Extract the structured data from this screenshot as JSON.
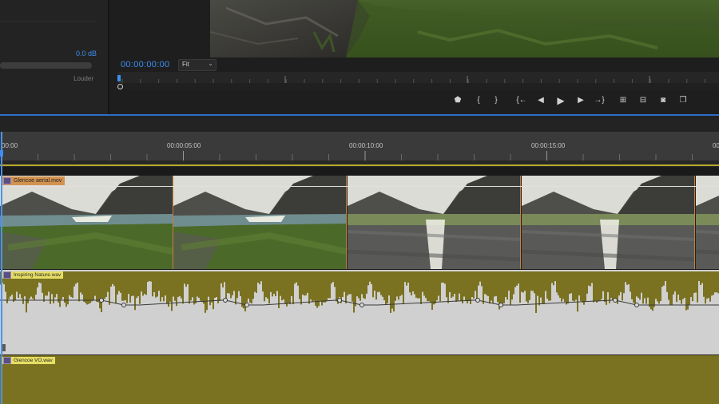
{
  "audio_mixer": {
    "gain_value": "0.0 dB",
    "slider_label": "Louder"
  },
  "program_monitor": {
    "timecode": "00:00:00:00",
    "zoom": "Fit"
  },
  "transport": {
    "buttons": [
      {
        "name": "add-marker",
        "glyph": "⬟"
      },
      {
        "name": "mark-in",
        "glyph": "{"
      },
      {
        "name": "mark-out",
        "glyph": "}"
      },
      {
        "name": "go-to-in",
        "glyph": "{←"
      },
      {
        "name": "step-back",
        "glyph": "◀"
      },
      {
        "name": "play",
        "glyph": "▶"
      },
      {
        "name": "step-forward",
        "glyph": "▶"
      },
      {
        "name": "go-to-out",
        "glyph": "→}"
      },
      {
        "name": "lift",
        "glyph": "⊞"
      },
      {
        "name": "extract",
        "glyph": "⊟"
      },
      {
        "name": "export-frame",
        "glyph": "◙"
      },
      {
        "name": "comparison-view",
        "glyph": "❐"
      }
    ]
  },
  "timeline": {
    "ruler_labels": [
      "00:00",
      "00:00:05:00",
      "00:00:10:00",
      "00:00:15:00",
      "00"
    ],
    "clips": {
      "video": "Glencoe aerial.mov",
      "music": "Inspiring Nature.wav",
      "voiceover": "Glencoe VO.wav"
    }
  },
  "colors": {
    "accent": "#3d8ff2",
    "video_clip_label": "#d39350",
    "audio_clip_label": "#e7df64",
    "audio_waveform": "#7a7221"
  }
}
